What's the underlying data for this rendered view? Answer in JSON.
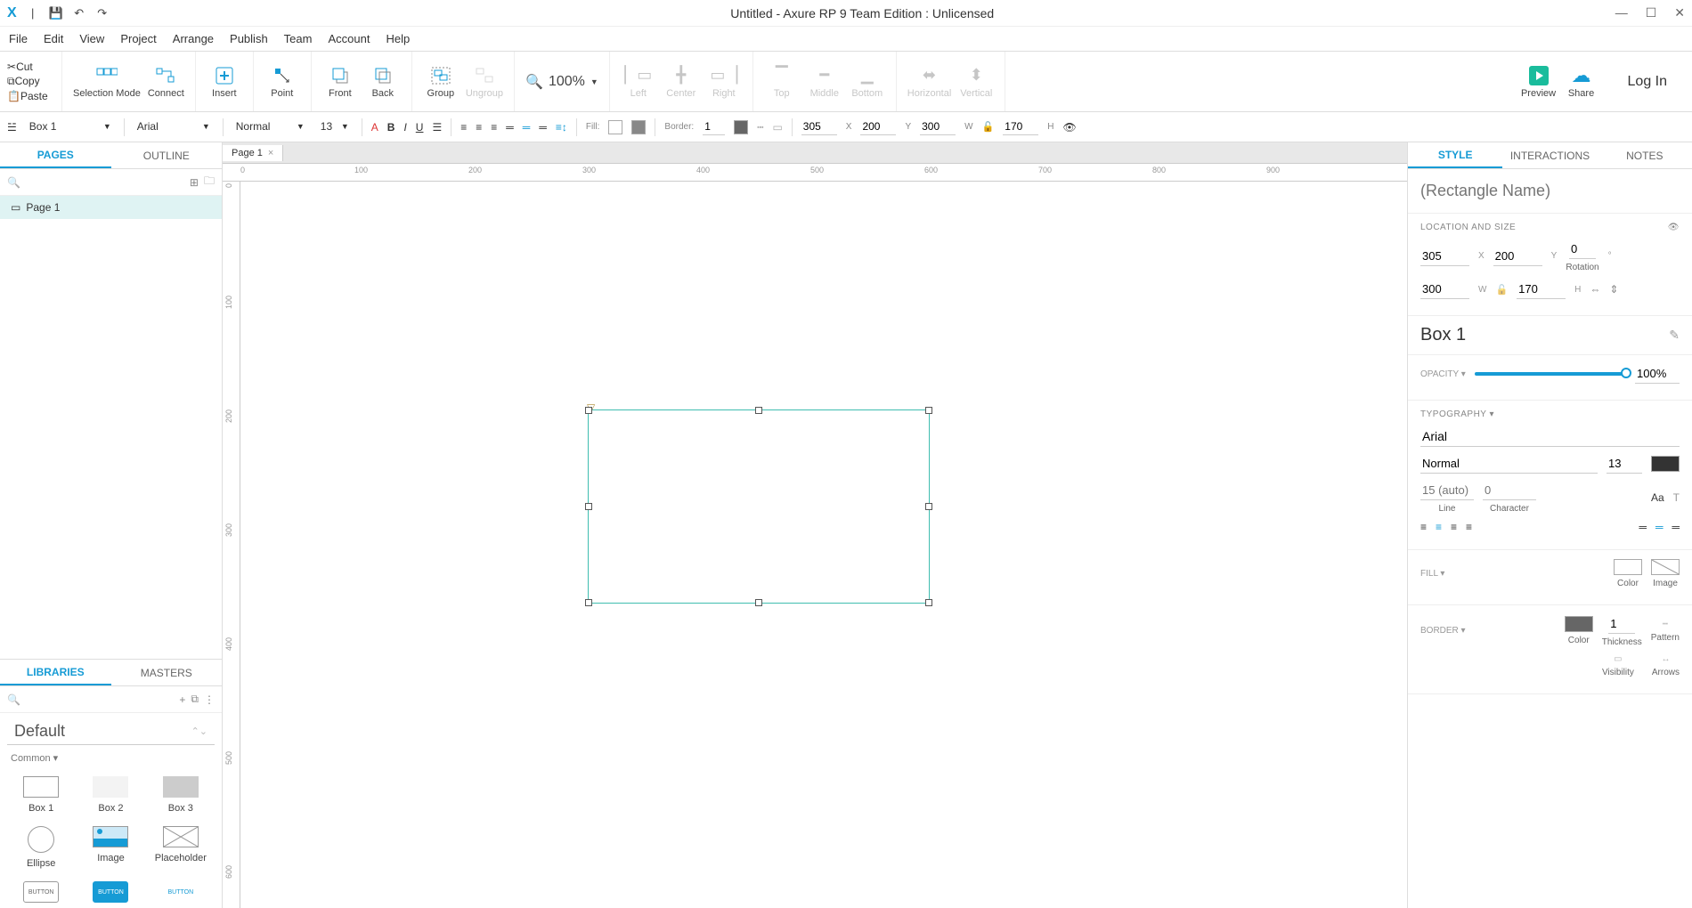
{
  "titlebar": {
    "title": "Untitled - Axure RP 9 Team Edition : Unlicensed"
  },
  "quickbar": {
    "cut": "Cut",
    "copy": "Copy",
    "paste": "Paste"
  },
  "menu": {
    "file": "File",
    "edit": "Edit",
    "view": "View",
    "project": "Project",
    "arrange": "Arrange",
    "publish": "Publish",
    "team": "Team",
    "account": "Account",
    "help": "Help"
  },
  "toolbar": {
    "selection_mode": "Selection Mode",
    "connect": "Connect",
    "insert": "Insert",
    "point": "Point",
    "front": "Front",
    "back": "Back",
    "group": "Group",
    "ungroup": "Ungroup",
    "zoom": "100%",
    "left": "Left",
    "center": "Center",
    "right": "Right",
    "top": "Top",
    "middle": "Middle",
    "bottom": "Bottom",
    "horizontal": "Horizontal",
    "vertical": "Vertical",
    "preview": "Preview",
    "share": "Share",
    "login": "Log In"
  },
  "optbar": {
    "widget_style": "Box 1",
    "font": "Arial",
    "typeface": "Normal",
    "font_size": "13",
    "fill_label": "Fill:",
    "border_label": "Border:",
    "border_w": "1",
    "x": "305",
    "y": "200",
    "w": "300",
    "h": "170"
  },
  "left_panel": {
    "tab_pages": "PAGES",
    "tab_outline": "OUTLINE",
    "page1": "Page 1",
    "tab_libraries": "LIBRARIES",
    "tab_masters": "MASTERS",
    "lib_name": "Default",
    "lib_group": "Common ▾",
    "items": {
      "box1": "Box 1",
      "box2": "Box 2",
      "box3": "Box 3",
      "ellipse": "Ellipse",
      "image": "Image",
      "placeholder": "Placeholder",
      "button": "BUTTON"
    }
  },
  "canvas": {
    "tab": "Page 1"
  },
  "right_panel": {
    "tab_style": "STYLE",
    "tab_interactions": "INTERACTIONS",
    "tab_notes": "NOTES",
    "name_placeholder": "(Rectangle Name)",
    "loc_label": "LOCATION AND SIZE",
    "x": "305",
    "y": "200",
    "rot": "0",
    "rot_label": "Rotation",
    "w": "300",
    "h": "170",
    "widget_style": "Box 1",
    "opacity_label": "OPACITY ▾",
    "opacity": "100%",
    "typo_label": "TYPOGRAPHY ▾",
    "font": "Arial",
    "typeface": "Normal",
    "font_size": "13",
    "line_ph": "15 (auto)",
    "char_ph": "0",
    "line_label": "Line",
    "char_label": "Character",
    "fill_label": "FILL ▾",
    "fill_color": "Color",
    "fill_image": "Image",
    "border_section": "BORDER ▾",
    "border_color": "Color",
    "border_thick": "1",
    "border_thick_label": "Thickness",
    "border_pattern": "Pattern",
    "visibility": "Visibility",
    "arrows": "Arrows"
  }
}
